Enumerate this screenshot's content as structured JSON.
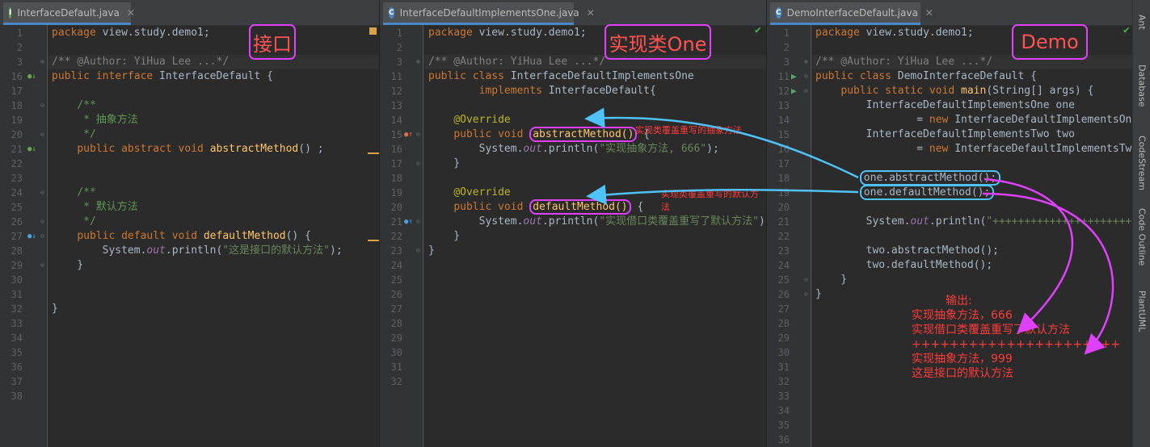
{
  "panes": [
    {
      "tab_title": "InterfaceDefault.java",
      "tab_icon": "interface-file-icon",
      "label": "接口",
      "line_numbers": [
        "1",
        "2",
        "3",
        "16",
        "17",
        "18",
        "19",
        "20",
        "21",
        "22",
        "23",
        "24",
        "25",
        "26",
        "27",
        "28",
        "29",
        "30",
        "31",
        "32",
        "33",
        "34",
        "35",
        "36",
        "37",
        "38"
      ]
    },
    {
      "tab_title": "InterfaceDefaultImplementsOne.java",
      "tab_icon": "class-file-icon",
      "label": "实现类One",
      "line_numbers": [
        "1",
        "2",
        "3",
        "11",
        "12",
        "13",
        "14",
        "15",
        "16",
        "17",
        "18",
        "19",
        "20",
        "21",
        "22",
        "23",
        "24",
        "25",
        "26",
        "27",
        "28",
        "29",
        "30",
        "31",
        "32"
      ],
      "note_abstract": "实现类覆盖重写的抽象方法",
      "note_default": "实现类覆盖重写的默认方法"
    },
    {
      "tab_title": "DemoInterfaceDefault.java",
      "tab_icon": "class-runnable-file-icon",
      "label": "Demo",
      "line_numbers": [
        "1",
        "2",
        "3",
        "11",
        "12",
        "13",
        "14",
        "15",
        "16",
        "17",
        "18",
        "19",
        "20",
        "21",
        "22",
        "23",
        "24",
        "25",
        "26",
        "27",
        "28",
        "29",
        "30",
        "31",
        "32",
        "33",
        "34",
        "35",
        "36"
      ]
    }
  ],
  "output": {
    "heading": "输出:",
    "lines": [
      "实现抽象方法，666",
      "实现借口类覆盖重写了默认方法",
      "++++++++++++++++++++++",
      "实现抽象方法，999",
      "这是接口的默认方法"
    ]
  },
  "sidebar": [
    "Ant",
    "Database",
    "CodeStream",
    "Code Outline",
    "PlantUML"
  ],
  "colors": {
    "highlight": "#e040fb",
    "arrow_blue": "#4fc3f7",
    "annotation_red": "#ff3b3b"
  }
}
